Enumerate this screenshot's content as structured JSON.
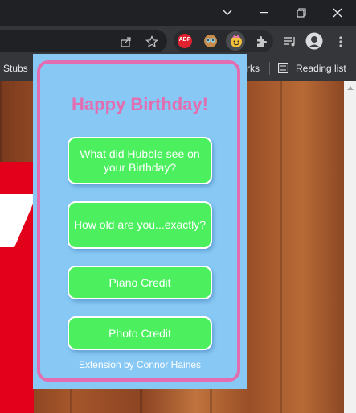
{
  "browser": {
    "bookmarks_bar": {
      "left_item": "Stubs",
      "right_fragment": "rks",
      "reading_list": "Reading list"
    },
    "extensions": {
      "abp_badge": "ABP"
    }
  },
  "popup": {
    "title": "Happy Birthday!",
    "buttons": [
      "What did Hubble see on your Birthday?",
      "How old are you...exactly?",
      "Piano Credit",
      "Photo Credit"
    ],
    "footer": "Extension by Connor Haines"
  },
  "colors": {
    "popup_bg": "#87c9f4",
    "accent_pink": "#e26db0",
    "button_green": "#4cf05e"
  }
}
